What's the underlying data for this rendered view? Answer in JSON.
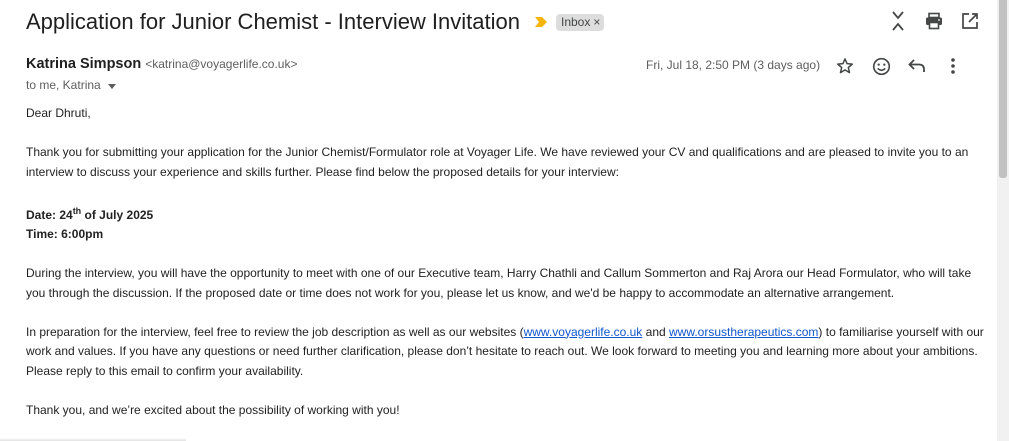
{
  "email": {
    "subject": "Application for Junior Chemist - Interview Invitation",
    "label": "Inbox",
    "label_remove": "×",
    "sender_name": "Katrina Simpson",
    "sender_email": "<katrina@voyagerlife.co.uk>",
    "recipients": "to me, Katrina",
    "date": "Fri, Jul 18, 2:50 PM (3 days ago)",
    "body": {
      "greeting": "Dear Dhruti,",
      "para1": "Thank you for submitting your application for the Junior Chemist/Formulator role at Voyager Life. We have reviewed your CV and qualifications and are pleased to invite you to an interview to discuss your experience and skills further. Please find below the proposed details for your interview:",
      "date_label": "Date: 24",
      "date_sup": "th",
      "date_rest": " of July 2025",
      "time_line": "Time: 6:00pm",
      "para2": "During the interview, you will have the opportunity to meet with one of our Executive team, Harry Chathli and Callum Sommerton and Raj Arora our Head Formulator, who will take you through the discussion. If the proposed date or time does not work for you, please let us know, and we'd be happy to accommodate an alternative arrangement.",
      "para3_start": "In preparation for the interview, feel free to review the job description as well as our websites (",
      "link1": "www.voyagerlife.co.uk",
      "para3_and": " and ",
      "link2": "www.orsustherapeutics.com",
      "para3_end": ") to familiarise yourself with our work and values. If you have any questions or need further clarification, please don’t hesitate to reach out. We look forward to meeting you and learning more about your ambitions. Please reply to this email to confirm your availability.",
      "closing": "Thank you, and we’re excited about the possibility of working with you!"
    }
  },
  "icons": [
    "importance-marker-icon",
    "collapse-all-icon",
    "print-icon",
    "open-in-new-window-icon",
    "star-icon",
    "emoji-reaction-icon",
    "reply-icon",
    "more-vertical-icon"
  ],
  "colors": {
    "importance": "#f4b400",
    "link": "#1155cc",
    "chip_bg": "#dddddd"
  }
}
